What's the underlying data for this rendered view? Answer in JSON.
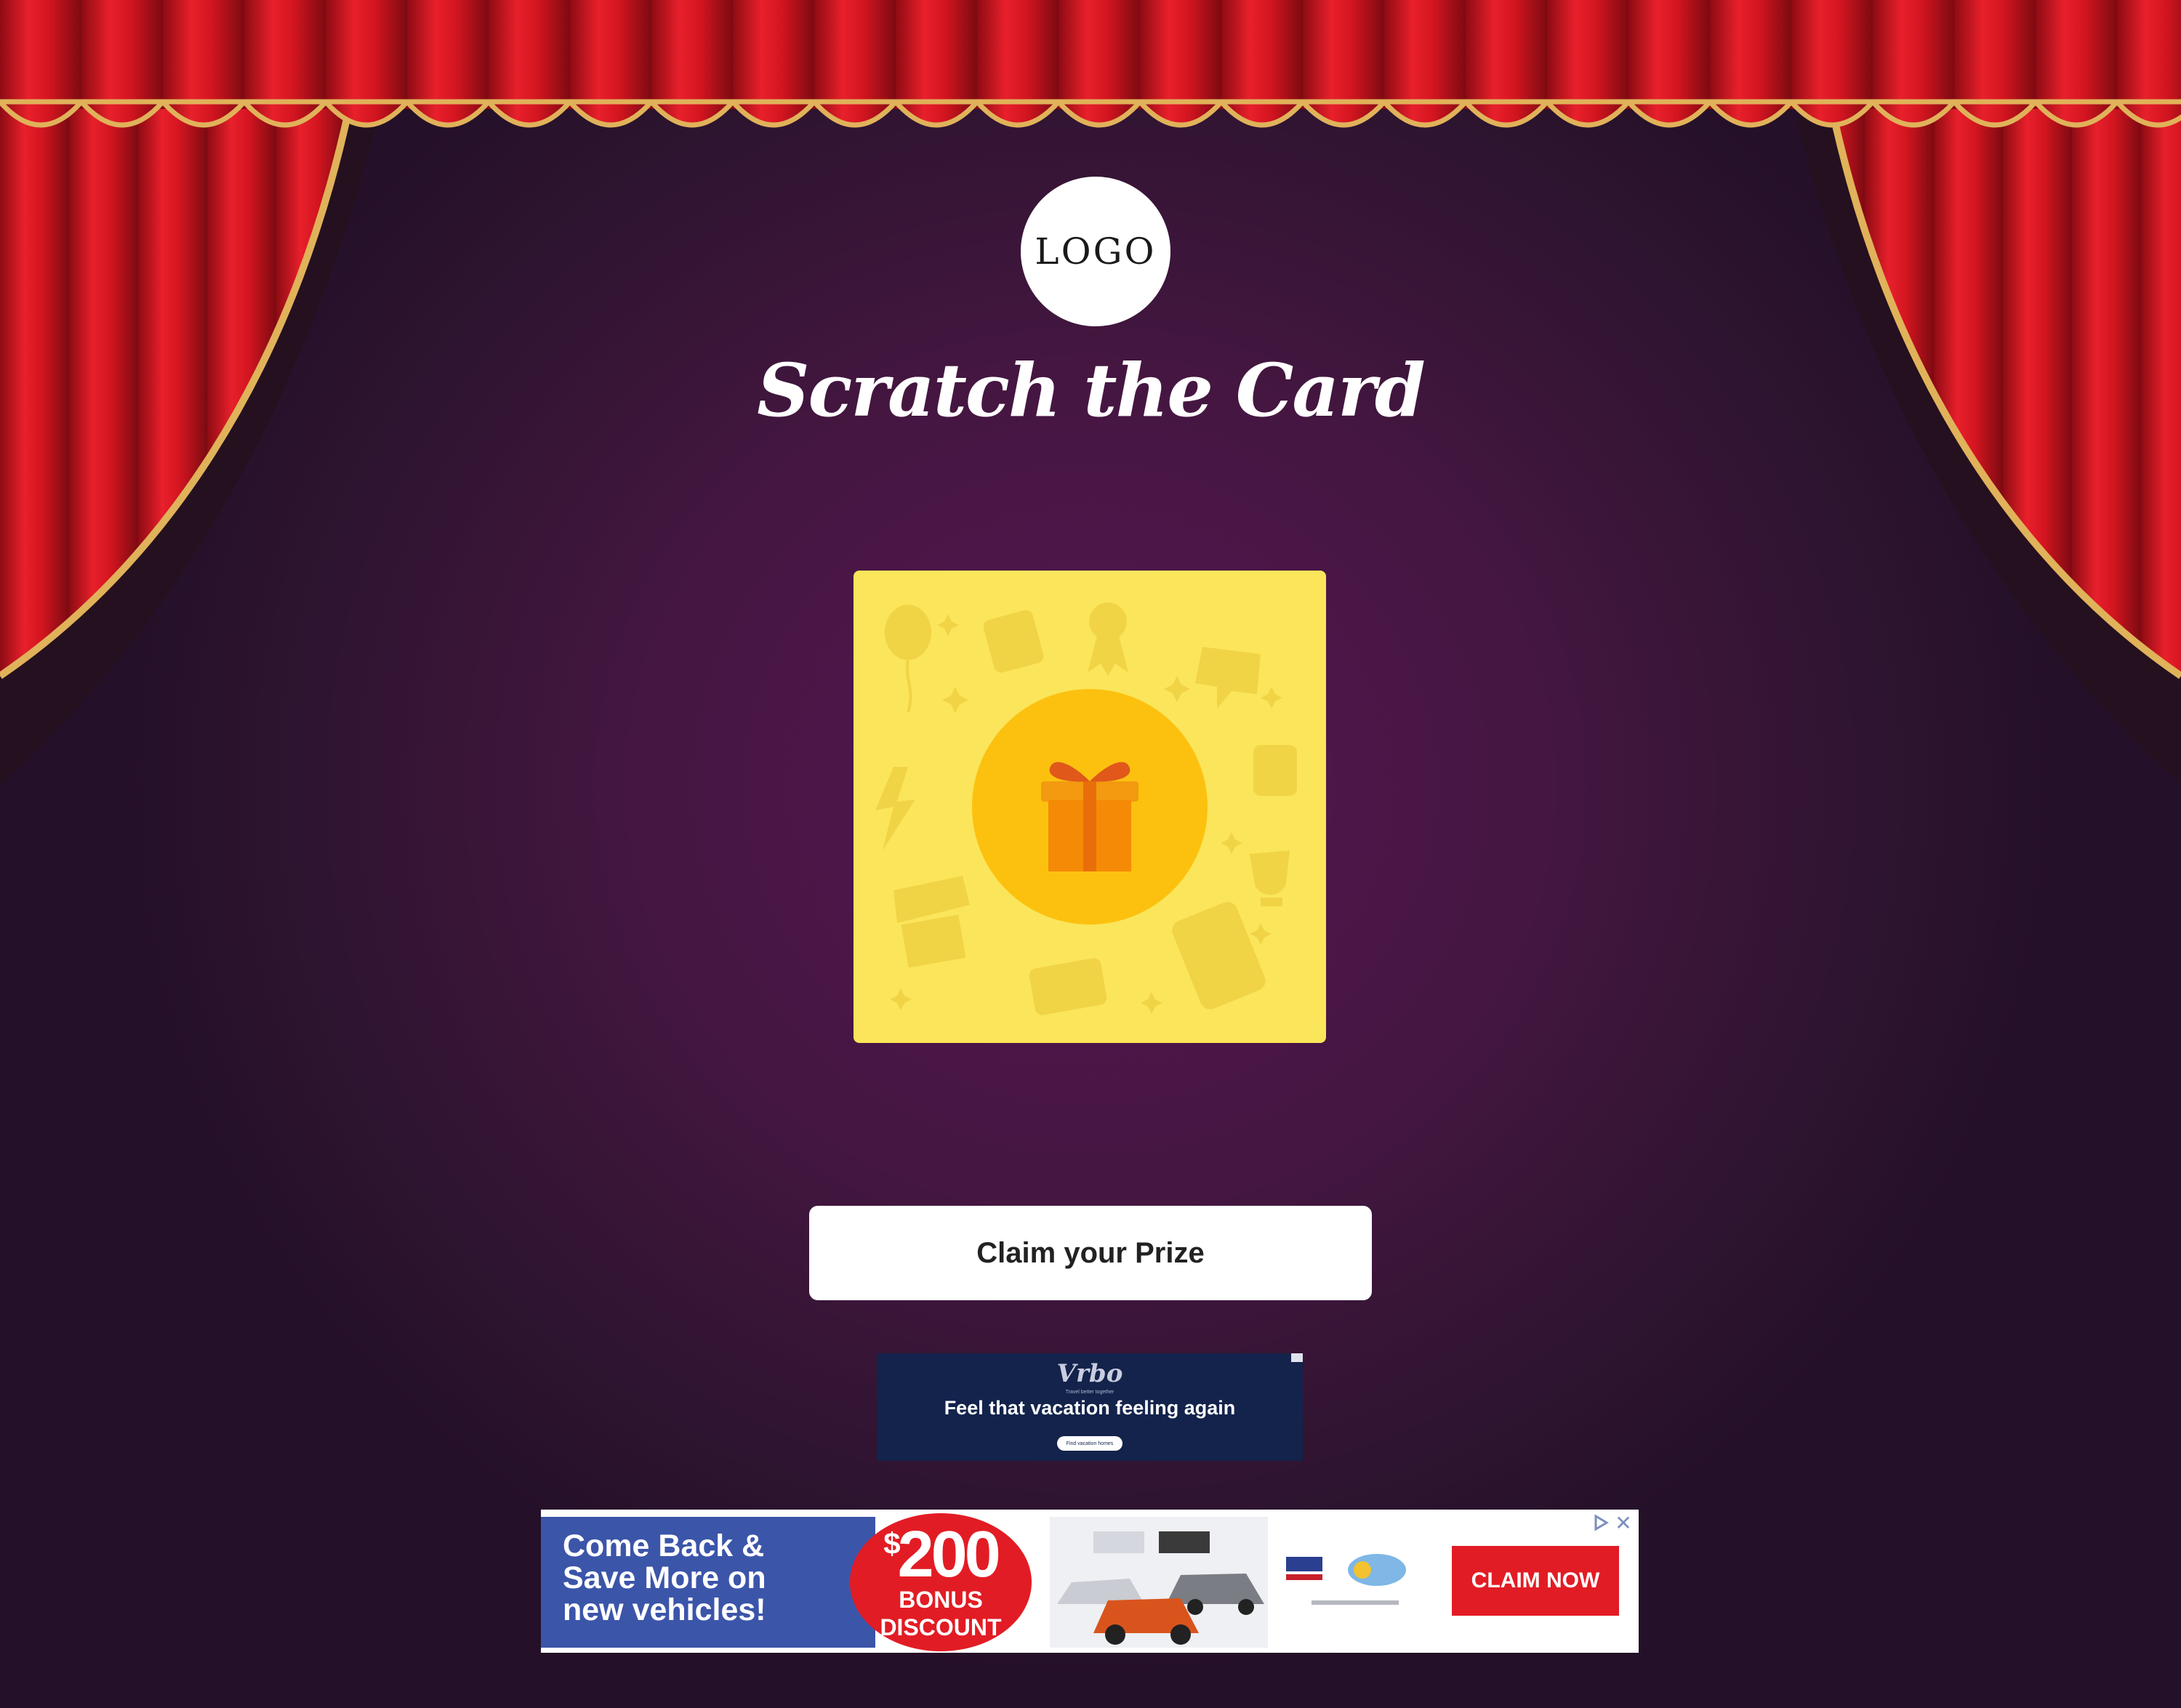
{
  "logo": {
    "text": "LOGO"
  },
  "title": "Scratch the Card",
  "card": {
    "center_icon": "gift-icon",
    "background_icons": [
      "balloon-icon",
      "wallet-icon",
      "ribbon-award-icon",
      "rupee-bubble-icon",
      "lightning-icon",
      "storefront-icon",
      "credit-card-icon",
      "trophy-icon",
      "smiley-phone-icon"
    ]
  },
  "claim_button": {
    "label": "Claim your Prize"
  },
  "ad_small": {
    "brand": "Vrbo",
    "tagline": "Travel better together",
    "headline": "Feel that vacation feeling again",
    "button": "Find vacation homes"
  },
  "ad_banner": {
    "lead": [
      "Come Back &",
      "Save More on",
      "new vehicles!"
    ],
    "amount_symbol": "$",
    "amount": "200",
    "bonus": [
      "BONUS",
      "DISCOUNT"
    ],
    "cta": "CLAIM NOW",
    "colors": {
      "blue": "#3b55a9",
      "red": "#e21c24"
    }
  },
  "colors": {
    "curtain": "#d8141f",
    "gold_trim": "#e0b25a",
    "card": "#fbe55a",
    "background": "#561852"
  }
}
